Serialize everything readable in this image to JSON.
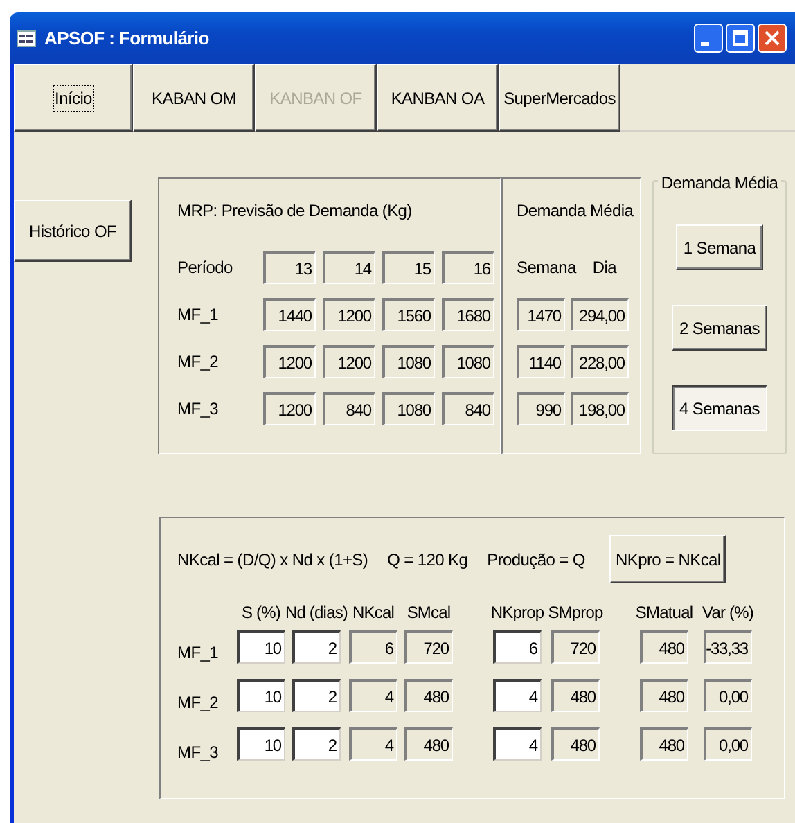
{
  "window": {
    "title": "APSOF : Formulário"
  },
  "tabs": [
    {
      "label": "Início",
      "focused": true,
      "disabled": false
    },
    {
      "label": "KABAN OM",
      "focused": false,
      "disabled": false
    },
    {
      "label": "KANBAN OF",
      "focused": false,
      "disabled": true
    },
    {
      "label": "KANBAN OA",
      "focused": false,
      "disabled": false
    },
    {
      "label": "SuperMercados",
      "focused": false,
      "disabled": false
    }
  ],
  "side_button": "Histórico OF",
  "mrp": {
    "title": "MRP: Previsão de Demanda (Kg)",
    "period_label": "Período",
    "periods": [
      "13",
      "14",
      "15",
      "16"
    ],
    "rows": [
      {
        "label": "MF_1",
        "values": [
          "1440",
          "1200",
          "1560",
          "1680"
        ]
      },
      {
        "label": "MF_2",
        "values": [
          "1200",
          "1200",
          "1080",
          "1080"
        ]
      },
      {
        "label": "MF_3",
        "values": [
          "1200",
          "840",
          "1080",
          "840"
        ]
      }
    ]
  },
  "average": {
    "title": "Demanda Média",
    "week_label": "Semana",
    "day_label": "Dia",
    "rows": [
      {
        "week": "1470",
        "day": "294,00"
      },
      {
        "week": "1140",
        "day": "228,00"
      },
      {
        "week": "990",
        "day": "198,00"
      }
    ]
  },
  "average_group": {
    "title": "Demanda Média",
    "buttons": [
      {
        "label": "1 Semana",
        "selected": false
      },
      {
        "label": "2 Semanas",
        "selected": false
      },
      {
        "label": "4 Semanas",
        "selected": true
      }
    ]
  },
  "calc": {
    "formulas": [
      "NKcal = (D/Q) x Nd x (1+S)",
      "Q = 120 Kg",
      "Produção = Q"
    ],
    "button": "NKpro = NKcal",
    "columns": [
      "S (%)",
      "Nd (dias)",
      "NKcal",
      "SMcal",
      "NKprop",
      "SMprop",
      "SMatual",
      "Var (%)"
    ],
    "rows": [
      {
        "label": "MF_1",
        "cells": [
          {
            "value": "10",
            "editable": true
          },
          {
            "value": "2",
            "editable": true
          },
          {
            "value": "6",
            "editable": false
          },
          {
            "value": "720",
            "editable": false
          },
          {
            "value": "6",
            "editable": true
          },
          {
            "value": "720",
            "editable": false
          },
          {
            "value": "480",
            "editable": false
          },
          {
            "value": "-33,33",
            "editable": false
          }
        ]
      },
      {
        "label": "MF_2",
        "cells": [
          {
            "value": "10",
            "editable": true
          },
          {
            "value": "2",
            "editable": true
          },
          {
            "value": "4",
            "editable": false
          },
          {
            "value": "480",
            "editable": false
          },
          {
            "value": "4",
            "editable": true
          },
          {
            "value": "480",
            "editable": false
          },
          {
            "value": "480",
            "editable": false
          },
          {
            "value": "0,00",
            "editable": false
          }
        ]
      },
      {
        "label": "MF_3",
        "cells": [
          {
            "value": "10",
            "editable": true
          },
          {
            "value": "2",
            "editable": true
          },
          {
            "value": "4",
            "editable": false
          },
          {
            "value": "480",
            "editable": false
          },
          {
            "value": "4",
            "editable": true
          },
          {
            "value": "480",
            "editable": false
          },
          {
            "value": "480",
            "editable": false
          },
          {
            "value": "0,00",
            "editable": false
          }
        ]
      }
    ]
  }
}
